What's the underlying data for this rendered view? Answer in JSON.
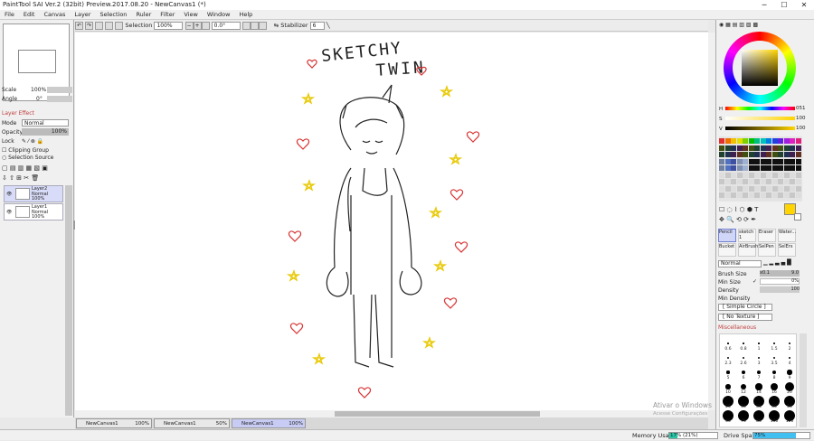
{
  "window": {
    "title": "PaintTool SAI Ver.2 (32bit) Preview.2017.08.20 - NewCanvas1 (*)",
    "minimize": "─",
    "maximize": "☐",
    "close": "✕"
  },
  "menu": [
    "File",
    "Edit",
    "Canvas",
    "Layer",
    "Selection",
    "Ruler",
    "Filter",
    "View",
    "Window",
    "Help"
  ],
  "toolbar": {
    "selection_label": "Selection",
    "zoom": "100%",
    "angle": "0.0°",
    "stabilizer_label": "Stabilizer",
    "stabilizer_value": "6"
  },
  "left": {
    "scale_label": "Scale",
    "scale_value": "100%",
    "angle_label": "Angle",
    "angle_value": "0°",
    "layer_effect": "Layer Effect",
    "mode_label": "Mode",
    "mode_value": "Normal",
    "opacity_label": "Opacity",
    "opacity_value": "100%",
    "lock_label": "Lock",
    "clipping_group": "Clipping Group",
    "selection_source": "Selection Source",
    "layers": [
      {
        "name": "Layer2",
        "mode": "Normal",
        "opacity": "100%"
      },
      {
        "name": "Layer1",
        "mode": "Normal",
        "opacity": "100%"
      }
    ]
  },
  "canvas": {
    "text_line1": "SKETCHY",
    "text_line2": "TWIN"
  },
  "tabs": [
    {
      "name": "NewCanvas1",
      "zoom": "100%"
    },
    {
      "name": "NewCanvas1",
      "zoom": "50%"
    },
    {
      "name": "NewCanvas1",
      "zoom": "100%"
    }
  ],
  "status": {
    "memory_label": "Memory Usage",
    "memory_value": "17% (21%)",
    "memory_fraction": 0.17,
    "drive_label": "Drive Space",
    "drive_value": "75%",
    "drive_fraction": 0.75
  },
  "watermark": {
    "line1": "Ativar o Windows",
    "line2": "Acesse Configurações"
  },
  "right": {
    "hsv": [
      {
        "label": "H",
        "value": "051"
      },
      {
        "label": "S",
        "value": "100"
      },
      {
        "label": "V",
        "value": "100"
      }
    ],
    "current_color": "#ffd400",
    "tools": [
      {
        "name": "Pencil",
        "size": ""
      },
      {
        "name": "sketch",
        "size": "1"
      },
      {
        "name": "Eraser",
        "size": ""
      },
      {
        "name": "Water...",
        "size": ""
      },
      {
        "name": "Bucket",
        "size": ""
      },
      {
        "name": "AirBrush",
        "size": ""
      },
      {
        "name": "SelPen",
        "size": ""
      },
      {
        "name": "SelErs",
        "size": ""
      }
    ],
    "blend_mode": "Normal",
    "brush_size_label": "Brush Size",
    "brush_size_mult": "x0.1",
    "brush_size_value": "9.0",
    "min_size_label": "Min Size",
    "min_size_value": "0%",
    "density_label": "Density",
    "density_value": "100",
    "min_density_label": "Min Density",
    "shape_value": "[ Simple Circle ]",
    "texture_value": "[ No Texture ]",
    "misc_label": "Miscellaneous",
    "brush_sizes": [
      "0.6",
      "0.8",
      "1",
      "1.5",
      "2",
      "2.3",
      "2.6",
      "3",
      "3.5",
      "4",
      "5",
      "6",
      "7",
      "8",
      "9",
      "10",
      "12",
      "14",
      "16",
      "20",
      "25",
      "30",
      "35",
      "40",
      "50",
      "60",
      "70",
      "80",
      "100",
      "120"
    ]
  }
}
